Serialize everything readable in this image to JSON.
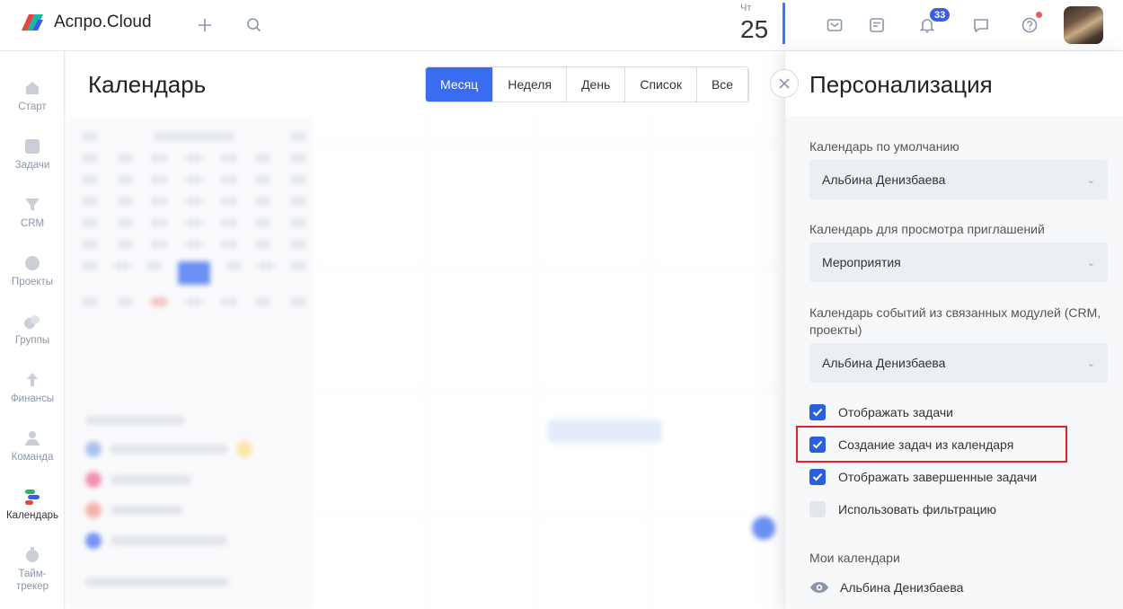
{
  "app": {
    "name": "Аспро.Cloud"
  },
  "topbar": {
    "date_weekday": "Чт",
    "date_day": "25",
    "notifications_count": "33"
  },
  "sidebar": {
    "items": [
      {
        "label": "Старт",
        "icon": "start-icon"
      },
      {
        "label": "Задачи",
        "icon": "tasks-icon"
      },
      {
        "label": "CRM",
        "icon": "crm-icon"
      },
      {
        "label": "Проекты",
        "icon": "projects-icon"
      },
      {
        "label": "Группы",
        "icon": "groups-icon"
      },
      {
        "label": "Финансы",
        "icon": "finance-icon"
      },
      {
        "label": "Команда",
        "icon": "team-icon"
      },
      {
        "label": "Календарь",
        "icon": "calendar-icon",
        "active": true
      },
      {
        "label": "Тайм-трекер",
        "icon": "timer-icon"
      }
    ]
  },
  "calendar": {
    "title": "Календарь",
    "views": [
      "Месяц",
      "Неделя",
      "День",
      "Список",
      "Все"
    ],
    "active_view": "Месяц"
  },
  "panel": {
    "title": "Персонализация",
    "default_calendar_label": "Календарь по умолчанию",
    "default_calendar_value": "Альбина Денизбаева",
    "invites_calendar_label": "Календарь для просмотра приглашений",
    "invites_calendar_value": "Мероприятия",
    "linked_calendar_label": "Календарь событий из связанных модулей (CRM, проекты)",
    "linked_calendar_value": "Альбина Денизбаева",
    "checkboxes": [
      {
        "label": "Отображать задачи",
        "checked": true
      },
      {
        "label": "Создание задач из календаря",
        "checked": true
      },
      {
        "label": "Отображать завершенные задачи",
        "checked": true
      },
      {
        "label": "Использовать фильтрацию",
        "checked": false
      }
    ],
    "my_calendars_label": "Мои календари",
    "my_calendar_owner": "Альбина Денизбаева"
  },
  "colors": {
    "accent": "#3a6cf0",
    "checkbox_on": "#2a5fe0",
    "highlight": "#e0232a",
    "badge": "#3b5ee8"
  }
}
